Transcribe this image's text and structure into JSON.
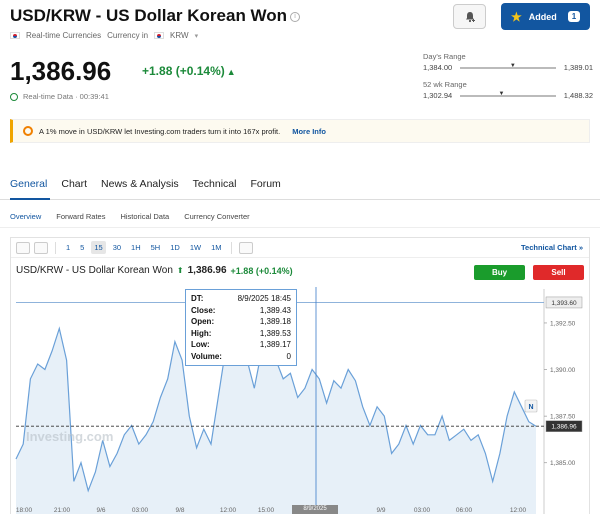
{
  "header": {
    "title": "USD/KRW - US Dollar Korean Won",
    "sub_realtime": "Real-time Currencies",
    "sub_currency_in": "Currency in",
    "sub_currency": "KRW",
    "added_label": "Added",
    "added_count": "1"
  },
  "quote": {
    "price": "1,386.96",
    "change": "+1.88",
    "change_pct": "(+0.14%)",
    "realtime_label": "Real-time Data · 00:39:41"
  },
  "ranges": {
    "day_label": "Day's Range",
    "day_low": "1,384.00",
    "day_high": "1,389.01",
    "wk_label": "52 wk Range",
    "wk_low": "1,302.94",
    "wk_high": "1,488.32"
  },
  "promo": {
    "text": "A 1% move in USD/KRW let Investing.com traders turn it into 167x profit.",
    "link": "More Info"
  },
  "tabs": [
    "General",
    "Chart",
    "News & Analysis",
    "Technical",
    "Forum"
  ],
  "subtabs": [
    "Overview",
    "Forward Rates",
    "Historical Data",
    "Currency Converter"
  ],
  "toolbar": {
    "intervals": [
      "1",
      "5",
      "15",
      "30",
      "1H",
      "5H",
      "1D",
      "1W",
      "1M"
    ],
    "selected": "15",
    "technical_chart": "Technical Chart »"
  },
  "chart_header": {
    "title": "USD/KRW - US Dollar Korean Won",
    "price": "1,386.96",
    "change": "+1.88",
    "change_pct": "(+0.14%)",
    "buy": "Buy",
    "sell": "Sell"
  },
  "tooltip": {
    "rows": [
      {
        "k": "DT:",
        "v": "8/9/2025 18:45"
      },
      {
        "k": "Close:",
        "v": "1,389.43"
      },
      {
        "k": "Open:",
        "v": "1,389.18"
      },
      {
        "k": "High:",
        "v": "1,389.53"
      },
      {
        "k": "Low:",
        "v": "1,389.17"
      },
      {
        "k": "Volume:",
        "v": "0"
      }
    ],
    "date_flag": "8/9/2025"
  },
  "watermark": "Investing.com",
  "colors": {
    "accent": "#1256a0",
    "up": "#1c8a3a",
    "buy": "#1a9c2c",
    "sell": "#e0292a",
    "line": "#6aa0d8",
    "fill": "#dde9f5"
  },
  "chart_data": {
    "type": "area",
    "x_tick_labels": [
      "18:00",
      "21:00",
      "9/6",
      "03:00",
      "9/8",
      "12:00",
      "15:00",
      "21:00",
      "9/9",
      "03:00",
      "06:00",
      "12:00"
    ],
    "y_tick_labels": [
      "1,385.00",
      "1,387.50",
      "1,390.00",
      "1,392.50"
    ],
    "ylim": [
      1383.0,
      1394.0
    ],
    "reference_lines": [
      {
        "label": "1,393.60",
        "value": 1393.6
      },
      {
        "label": "1,386.96",
        "value": 1386.96
      }
    ],
    "series": [
      {
        "values": [
          1385.2,
          1386.0,
          1389.5,
          1390.3,
          1390.0,
          1391.0,
          1392.2,
          1390.5,
          1384.0,
          1385.0,
          1383.5,
          1384.5,
          1386.2,
          1384.8,
          1385.5,
          1386.5,
          1387.0,
          1386.0,
          1386.5,
          1387.2,
          1388.5,
          1389.5,
          1391.5,
          1390.5,
          1387.5,
          1385.8,
          1386.8,
          1386.0,
          1388.5,
          1391.0,
          1392.5,
          1391.5,
          1390.5,
          1389.0,
          1391.0,
          1392.0,
          1390.5,
          1389.5,
          1389.8,
          1388.5,
          1389.0,
          1390.0,
          1389.5,
          1388.2,
          1389.4,
          1389.0,
          1390.0,
          1389.4,
          1388.0,
          1387.0,
          1388.0,
          1387.5,
          1385.5,
          1386.0,
          1387.0,
          1386.0,
          1387.0,
          1386.5,
          1386.5,
          1387.5,
          1386.2,
          1386.5,
          1386.8,
          1386.2,
          1386.5,
          1385.5,
          1384.0,
          1385.5,
          1387.5,
          1388.8,
          1388.0,
          1387.2,
          1386.96
        ]
      }
    ]
  }
}
